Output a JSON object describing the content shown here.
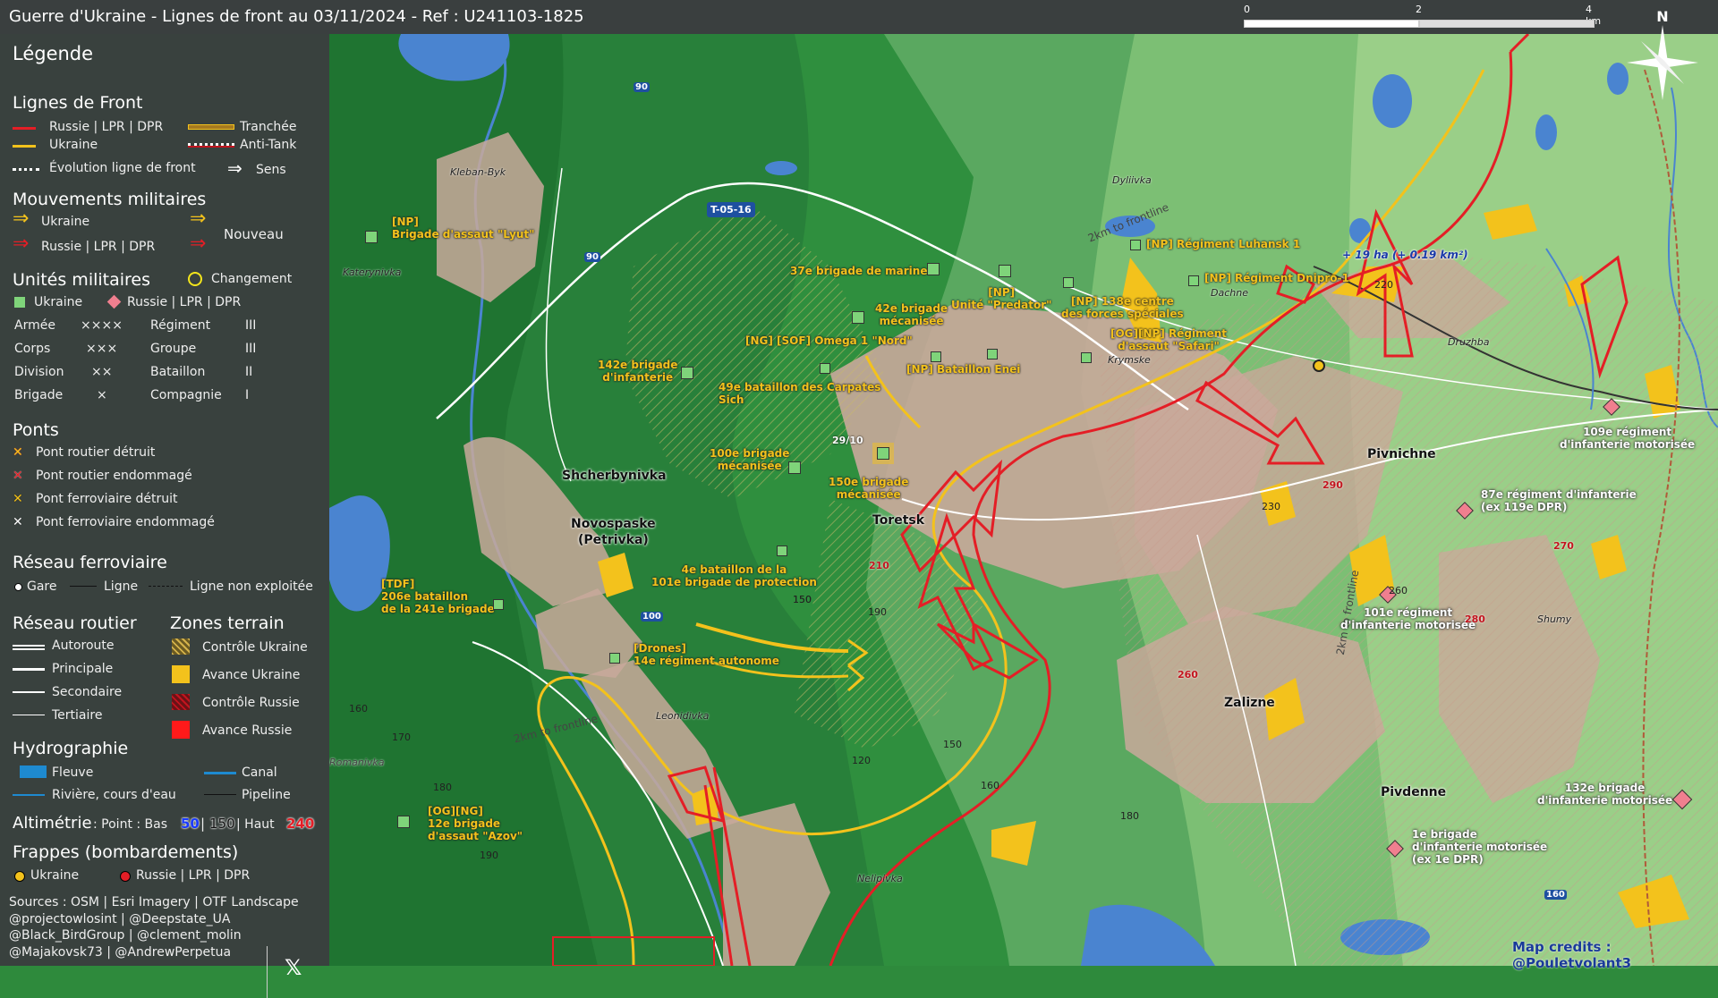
{
  "title": "Guerre d'Ukraine - Lignes de front au 03/11/2024 - Ref : U241103-1825",
  "scale": {
    "l0": "0",
    "l2": "2",
    "l4": "4 km"
  },
  "north": "N",
  "legend": {
    "title": "Légende",
    "front": {
      "title": "Lignes de Front",
      "russia": "Russie | LPR | DPR",
      "ukraine": "Ukraine",
      "trench": "Tranchée",
      "antitank": "Anti-Tank",
      "evolution": "Évolution ligne de front",
      "sens": "Sens"
    },
    "moves": {
      "title": "Mouvements militaires",
      "ukraine": "Ukraine",
      "russia": "Russie | LPR | DPR",
      "nouveau": "Nouveau"
    },
    "units": {
      "title": "Unités militaires",
      "change": "Changement",
      "ukraine": "Ukraine",
      "russia": "Russie | LPR | DPR",
      "rows": [
        {
          "a": "Armée",
          "as": "××××",
          "b": "Régiment",
          "bs": "III"
        },
        {
          "a": "Corps",
          "as": "×××",
          "b": "Groupe",
          "bs": "III"
        },
        {
          "a": "Division",
          "as": "××",
          "b": "Bataillon",
          "bs": "II"
        },
        {
          "a": "Brigade",
          "as": "×",
          "b": "Compagnie",
          "bs": "I"
        }
      ]
    },
    "bridges": {
      "title": "Ponts",
      "r_destroyed": "Pont routier détruit",
      "r_damaged": "Pont routier endommagé",
      "f_destroyed": "Pont ferroviaire détruit",
      "f_damaged": "Pont ferroviaire endommagé"
    },
    "rail": {
      "title": "Réseau ferroviaire",
      "gare": "Gare",
      "ligne": "Ligne",
      "non": "Ligne non exploitée"
    },
    "road": {
      "title": "Réseau routier",
      "autoroute": "Autoroute",
      "principale": "Principale",
      "secondaire": "Secondaire",
      "tertiaire": "Tertiaire"
    },
    "zones": {
      "title": "Zones terrain",
      "cu": "Contrôle Ukraine",
      "au": "Avance Ukraine",
      "cr": "Contrôle Russie",
      "ar": "Avance Russie"
    },
    "hydro": {
      "title": "Hydrographie",
      "fleuve": "Fleuve",
      "canal": "Canal",
      "riviere": "Rivière, cours d'eau",
      "pipeline": "Pipeline"
    },
    "alti": {
      "title": "Altimétrie",
      "text": ": Point : Bas",
      "low": "50",
      "mid": "150",
      "high_label": "| Haut",
      "high": "240"
    },
    "strikes": {
      "title": "Frappes (bombardements)",
      "ukraine": "Ukraine",
      "russia": "Russie | LPR | DPR"
    },
    "credits": [
      "Sources : OSM | Esri Imagery | OTF Landscape",
      "@projectowlosint | @Deepstate_UA",
      "@Black_BirdGroup | @clement_molin",
      "@Majakovsk73 | @AndrewPerpetua"
    ],
    "x": "𝕏"
  },
  "map": {
    "towns": [
      "Toretsk",
      "Pivnichne",
      "Shcherbynivka",
      "Novospaske",
      "(Petrivka)",
      "Zalizne",
      "Pivdenne"
    ],
    "villages": [
      "Kleban-Byk",
      "Katerynivka",
      "Dyliivka",
      "Dachne",
      "Krymske",
      "Druzhba",
      "Leonidivka",
      "Nelipivka",
      "Shumy",
      "Romanivka"
    ],
    "roads": [
      "90",
      "90",
      "100",
      "160",
      "T-05-16"
    ],
    "frontline": [
      "2km to frontline",
      "2km to frontline",
      "2km to frontline"
    ],
    "units": [
      {
        "name": "[NP]\nBrigade d'assaut \"Lyut\""
      },
      {
        "name": "37e brigade de marine"
      },
      {
        "name": "42e brigade\nmécanisée"
      },
      {
        "name": "[NP]\nUnité \"Predator\""
      },
      {
        "name": "[NP] Régiment Luhansk 1"
      },
      {
        "name": "[NP] Régiment Dnipro-1"
      },
      {
        "name": "[NP] 138e centre\ndes forces spéciales"
      },
      {
        "name": "[OG][NP] Régiment\nd'assaut \"Safari\""
      },
      {
        "name": "[NG] [SOF] Omega 1 \"Nord\""
      },
      {
        "name": "[NP] Bataillon Enei"
      },
      {
        "name": "142e brigade\nd'infanterie"
      },
      {
        "name": "49e bataillon des Carpates\nSich"
      },
      {
        "name": "100e brigade\nmécanisée"
      },
      {
        "name": "150e brigade\nmécanisée"
      },
      {
        "name": "4e bataillon de la\n101e brigade de protection"
      },
      {
        "name": "[TDF]\n206e bataillon\nde la 241e brigade"
      },
      {
        "name": "[Drones]\n14e régiment autonome"
      },
      {
        "name": "[OG][NG]\n12e brigade\nd'assaut \"Azov\""
      }
    ],
    "ru_units": [
      {
        "name": "109e régiment\nd'infanterie motorisée"
      },
      {
        "name": "87e régiment d'infanterie\n(ex 119e DPR)"
      },
      {
        "name": "101e régiment\nd'infanterie motorisée"
      },
      {
        "name": "132e brigade\nd'infanterie motorisée"
      },
      {
        "name": "1e brigade\nd'infanterie motorisée\n(ex 1e DPR)"
      }
    ],
    "gain": "+ 19 ha (+ 0.19 km²)",
    "date": "29/10",
    "altitudes": [
      "220",
      "230",
      "260",
      "160",
      "150",
      "170",
      "180",
      "190",
      "120",
      "150",
      "160",
      "180",
      "190",
      "150"
    ],
    "alt_red": [
      "290",
      "270",
      "210",
      "280",
      "260"
    ],
    "credit": "Map credits : @Pouletvolant3"
  },
  "colors": {
    "russia": "#e41e26",
    "ukraine": "#f3c21c",
    "panel": "#3a3e3e",
    "water": "#4a84d0"
  }
}
